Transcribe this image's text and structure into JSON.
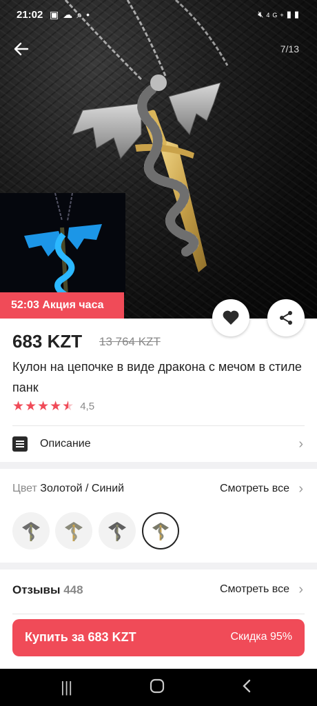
{
  "status_bar": {
    "time": "21:02",
    "left_icons": [
      "image-icon",
      "cloud-icon",
      "search-icon",
      "dot-icon"
    ],
    "right_icons": [
      "mute-icon",
      "network-4g-icon",
      "signal-icon",
      "battery-icon"
    ],
    "network_label": "4G+"
  },
  "gallery": {
    "counter": "7/13",
    "promo_badge": "52:03 Акция часа"
  },
  "product": {
    "price": "683 KZT",
    "old_price": "13 764 KZT",
    "title": "Кулон на цепочке в виде дракона с мечом в стиле панк",
    "rating_value": "4,5",
    "rating_stars": 4.5
  },
  "description": {
    "label": "Описание"
  },
  "color": {
    "label": "Цвет",
    "value": "Золотой / Синий",
    "see_all": "Смотреть все",
    "options_count": 4,
    "selected_index": 3
  },
  "reviews": {
    "label": "Отзывы",
    "count": "448",
    "see_all": "Смотреть все"
  },
  "buy": {
    "label": "Купить за 683 KZT",
    "discount": "Скидка 95%"
  },
  "colors": {
    "accent": "#f04b58",
    "text": "#222222",
    "muted": "#888888"
  }
}
